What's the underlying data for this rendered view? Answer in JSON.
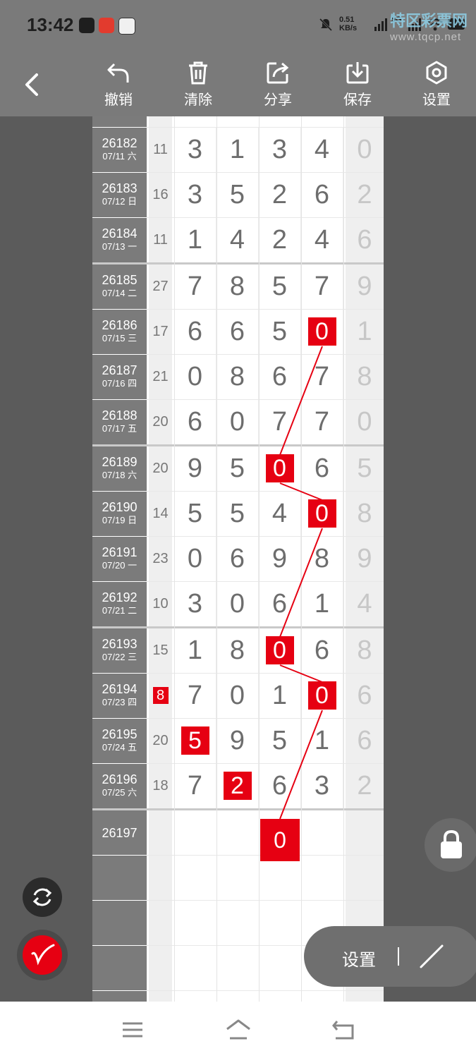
{
  "status_bar": {
    "time": "13:42",
    "net_speed": "0.51\nKB/s",
    "network": "5G",
    "watermark_title": "特区彩票网",
    "watermark_url": "www.tqcp.net"
  },
  "toolbar": {
    "back_icon": "chevron-left-icon",
    "tools": [
      {
        "label": "撤销",
        "icon": "undo-icon"
      },
      {
        "label": "清除",
        "icon": "trash-icon"
      },
      {
        "label": "分享",
        "icon": "share-icon"
      },
      {
        "label": "保存",
        "icon": "download-icon"
      },
      {
        "label": "设置",
        "icon": "hexagon-settings-icon"
      }
    ]
  },
  "rows": [
    {
      "period": "26182",
      "date": "07/11 六",
      "sum": "11",
      "digits": [
        "3",
        "1",
        "3",
        "4"
      ],
      "extra": "0"
    },
    {
      "period": "26183",
      "date": "07/12 日",
      "sum": "16",
      "digits": [
        "3",
        "5",
        "2",
        "6"
      ],
      "extra": "2"
    },
    {
      "period": "26184",
      "date": "07/13 一",
      "sum": "11",
      "digits": [
        "1",
        "4",
        "2",
        "4"
      ],
      "extra": "6"
    },
    {
      "period": "26185",
      "date": "07/14 二",
      "sum": "27",
      "digits": [
        "7",
        "8",
        "5",
        "7"
      ],
      "extra": "9"
    },
    {
      "period": "26186",
      "date": "07/15 三",
      "sum": "17",
      "digits": [
        "6",
        "6",
        "5",
        "0"
      ],
      "extra": "1"
    },
    {
      "period": "26187",
      "date": "07/16 四",
      "sum": "21",
      "digits": [
        "0",
        "8",
        "6",
        "7"
      ],
      "extra": "8"
    },
    {
      "period": "26188",
      "date": "07/17 五",
      "sum": "20",
      "digits": [
        "6",
        "0",
        "7",
        "7"
      ],
      "extra": "0"
    },
    {
      "period": "26189",
      "date": "07/18 六",
      "sum": "20",
      "digits": [
        "9",
        "5",
        "0",
        "6"
      ],
      "extra": "5"
    },
    {
      "period": "26190",
      "date": "07/19 日",
      "sum": "14",
      "digits": [
        "5",
        "5",
        "4",
        "0"
      ],
      "extra": "8"
    },
    {
      "period": "26191",
      "date": "07/20 一",
      "sum": "23",
      "digits": [
        "0",
        "6",
        "9",
        "8"
      ],
      "extra": "9"
    },
    {
      "period": "26192",
      "date": "07/21 二",
      "sum": "10",
      "digits": [
        "3",
        "0",
        "6",
        "1"
      ],
      "extra": "4"
    },
    {
      "period": "26193",
      "date": "07/22 三",
      "sum": "15",
      "digits": [
        "1",
        "8",
        "0",
        "6"
      ],
      "extra": "8"
    },
    {
      "period": "26194",
      "date": "07/23 四",
      "sum": "8",
      "digits": [
        "7",
        "0",
        "1",
        "0"
      ],
      "extra": "6"
    },
    {
      "period": "26195",
      "date": "07/24 五",
      "sum": "20",
      "digits": [
        "5",
        "9",
        "5",
        "1"
      ],
      "extra": "6"
    },
    {
      "period": "26196",
      "date": "07/25 六",
      "sum": "18",
      "digits": [
        "7",
        "2",
        "6",
        "3"
      ],
      "extra": "2"
    }
  ],
  "highlights": [
    {
      "row": 4,
      "col": 3
    },
    {
      "row": 7,
      "col": 2
    },
    {
      "row": 8,
      "col": 3
    },
    {
      "row": 11,
      "col": 2
    },
    {
      "row": 12,
      "col": 3
    },
    {
      "row": 13,
      "col": 0
    },
    {
      "row": 14,
      "col": 1
    }
  ],
  "highlighted_sum_row": 12,
  "next": {
    "period": "26197",
    "prediction": "0"
  },
  "floating": {
    "refresh_icon": "refresh-icon",
    "pen_icon": "pen-icon",
    "lock_icon": "lock-icon",
    "settings_label": "设置",
    "line_tool_icon": "line-tool-icon"
  },
  "navbar": {
    "icons": [
      "menu-icon",
      "home-icon",
      "back-icon"
    ]
  },
  "colors": {
    "highlight": "#e60012",
    "trend_line": "#e60012"
  }
}
